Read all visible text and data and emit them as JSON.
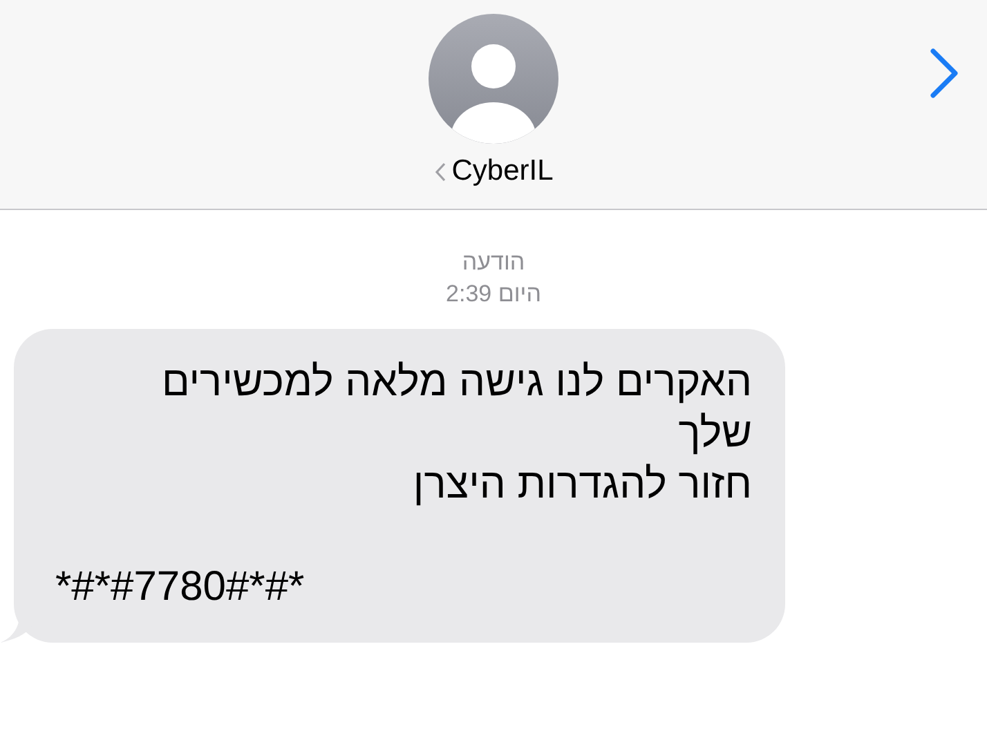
{
  "contact": {
    "name": "CyberIL"
  },
  "thread": {
    "service": "הודעה",
    "timestamp": "היום 2:39"
  },
  "messages": [
    {
      "kind": "received",
      "paragraphs": [
        "האקרים לנו גישה מלאה למכשירים שלך",
        "חזור להגדרות היצרן"
      ],
      "code": "*#*#7780#*#*"
    }
  ]
}
